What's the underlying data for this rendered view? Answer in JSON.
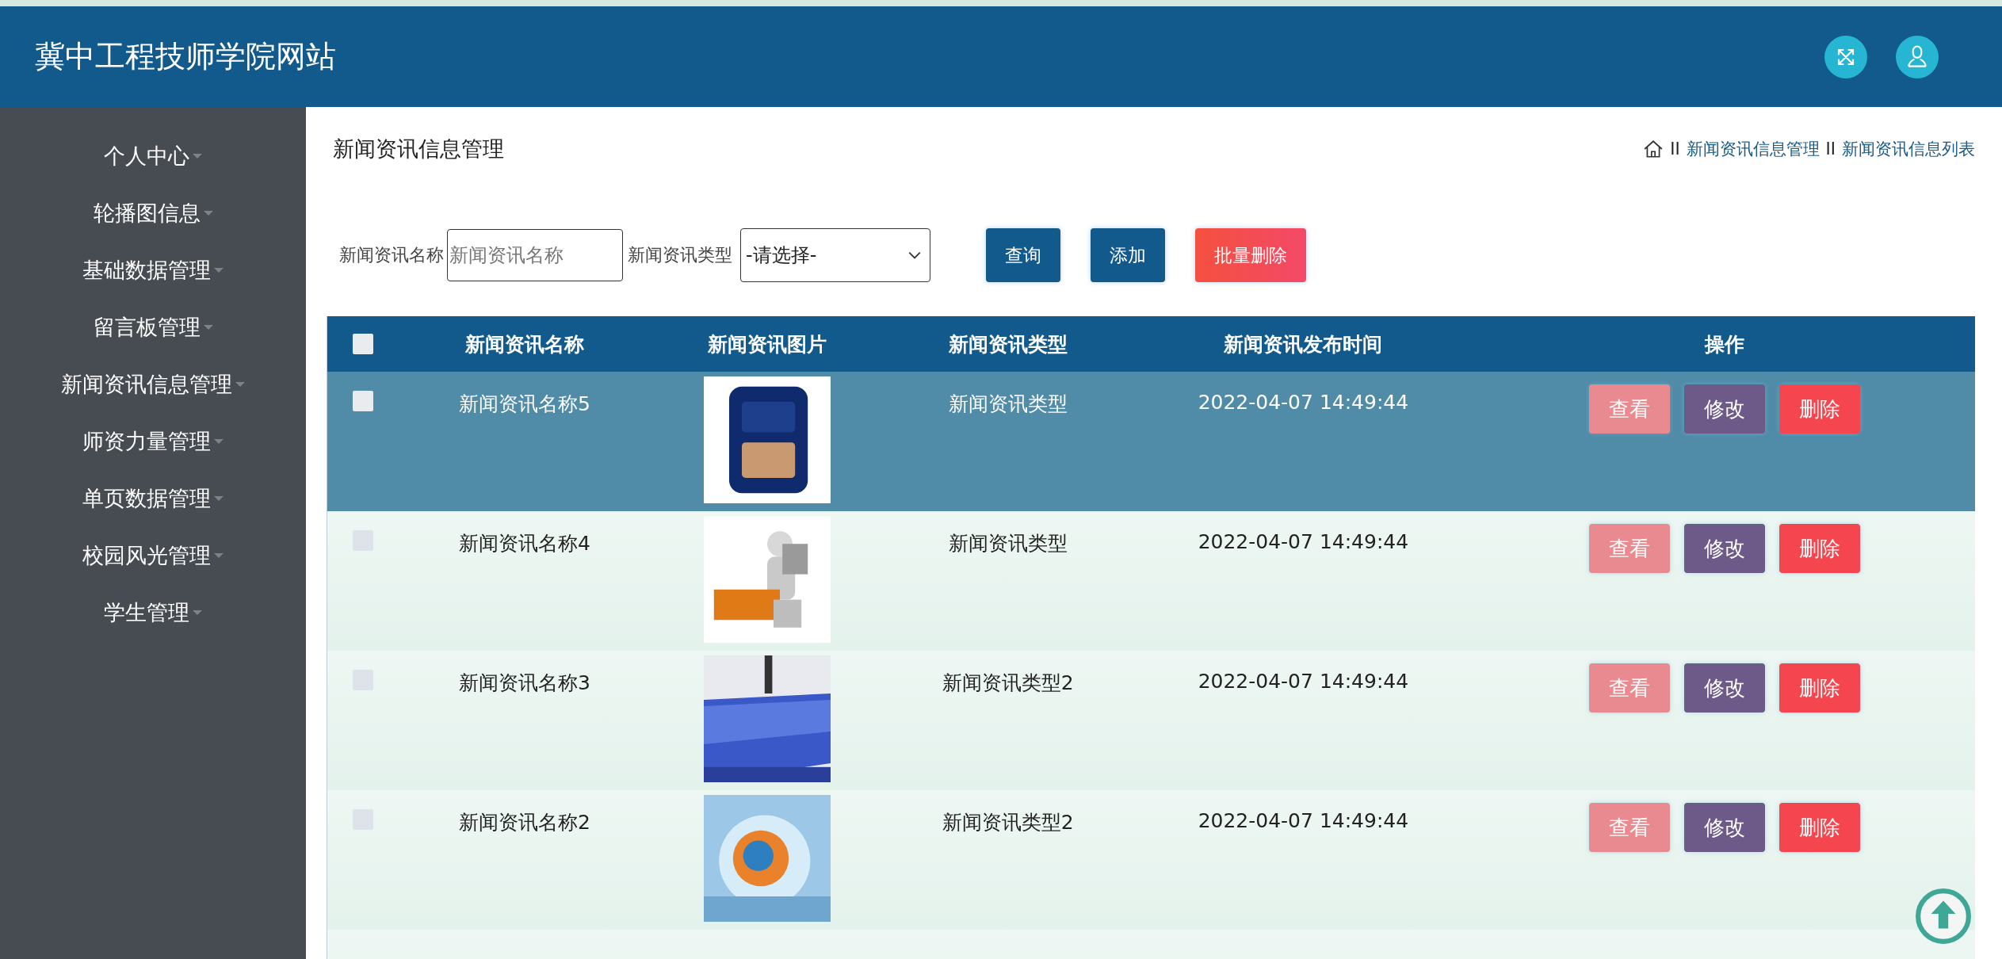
{
  "header": {
    "title": "冀中工程技师学院网站"
  },
  "sidebar": {
    "items": [
      {
        "label": "个人中心"
      },
      {
        "label": "轮播图信息"
      },
      {
        "label": "基础数据管理"
      },
      {
        "label": "留言板管理"
      },
      {
        "label": "新闻资讯信息管理"
      },
      {
        "label": "师资力量管理"
      },
      {
        "label": "单页数据管理"
      },
      {
        "label": "校园风光管理"
      },
      {
        "label": "学生管理"
      }
    ]
  },
  "page": {
    "title": "新闻资讯信息管理",
    "breadcrumb": [
      {
        "separator": "II",
        "label": "新闻资讯信息管理"
      },
      {
        "separator": "II",
        "label": "新闻资讯信息列表"
      }
    ]
  },
  "search": {
    "name_label": "新闻资讯名称",
    "name_placeholder": "新闻资讯名称",
    "type_label": "新闻资讯类型",
    "type_value": "-请选择-",
    "buttons": [
      {
        "label": "查询",
        "kind": "primary"
      },
      {
        "label": "添加",
        "kind": "primary"
      },
      {
        "label": "批量删除",
        "kind": "danger"
      }
    ]
  },
  "table": {
    "select_all_checked": false,
    "columns": [
      "新闻资讯名称",
      "新闻资讯图片",
      "新闻资讯类型",
      "新闻资讯发布时间",
      "操作"
    ],
    "rows": [
      {
        "name": "新闻资讯名称5",
        "type": "新闻资讯类型",
        "time": "2022-04-07 14:49:44",
        "selected": true,
        "checked": false,
        "actions": [
          {
            "label": "查看",
            "kind": "view"
          },
          {
            "label": "修改",
            "kind": "edit"
          },
          {
            "label": "删除",
            "kind": "delete"
          }
        ]
      },
      {
        "name": "新闻资讯名称4",
        "type": "新闻资讯类型",
        "time": "2022-04-07 14:49:44",
        "selected": false,
        "checked": false,
        "actions": [
          {
            "label": "查看",
            "kind": "view"
          },
          {
            "label": "修改",
            "kind": "edit"
          },
          {
            "label": "删除",
            "kind": "delete"
          }
        ]
      },
      {
        "name": "新闻资讯名称3",
        "type": "新闻资讯类型2",
        "time": "2022-04-07 14:49:44",
        "selected": false,
        "checked": false,
        "actions": [
          {
            "label": "查看",
            "kind": "view"
          },
          {
            "label": "修改",
            "kind": "edit"
          },
          {
            "label": "删除",
            "kind": "delete"
          }
        ]
      },
      {
        "name": "新闻资讯名称2",
        "type": "新闻资讯类型2",
        "time": "2022-04-07 14:49:44",
        "selected": false,
        "checked": false,
        "actions": [
          {
            "label": "查看",
            "kind": "view"
          },
          {
            "label": "修改",
            "kind": "edit"
          },
          {
            "label": "删除",
            "kind": "delete"
          }
        ]
      }
    ]
  }
}
